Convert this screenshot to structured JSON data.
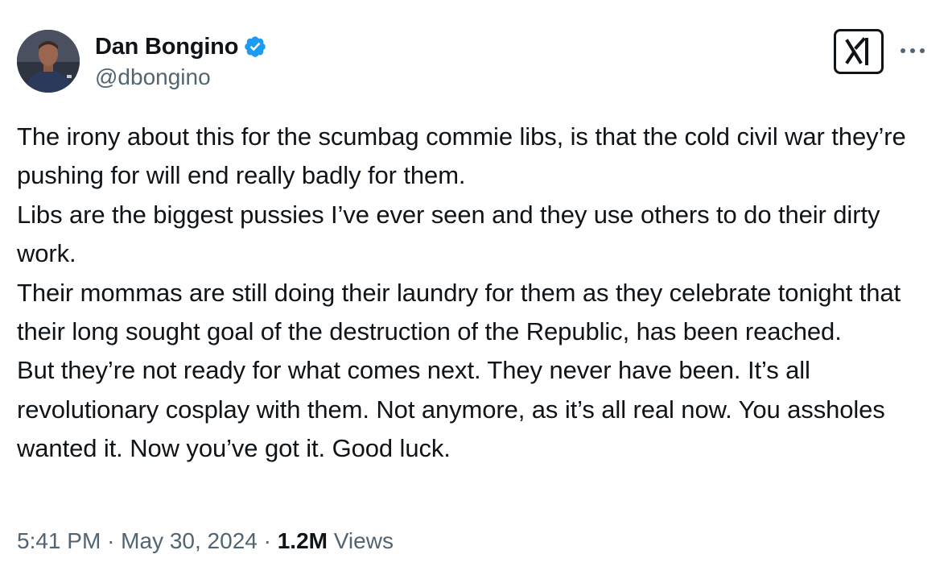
{
  "author": {
    "display_name": "Dan Bongino",
    "handle": "@dbongino",
    "verified_color": "#1d9bf0"
  },
  "header_actions": {
    "logo_icon": "grok-icon",
    "more_icon": "more-icon"
  },
  "tweet": {
    "text": "The irony about this for the scumbag commie libs, is that the cold civil war they’re pushing for will end really badly for them.\nLibs are the biggest pussies I’ve ever seen and they use others to do their dirty work.\nTheir mommas are still doing their laundry for them as they celebrate tonight that their long sought goal of the destruction of the Republic, has been reached.\nBut they’re not ready for what comes next. They never have been. It’s all revolutionary cosplay with them. Not anymore, as it’s all real now. You assholes wanted it. Now you’ve got it. Good luck."
  },
  "meta": {
    "time": "5:41 PM",
    "separator": "·",
    "date": "May 30, 2024",
    "views_count": "1.2M",
    "views_label": "Views"
  }
}
